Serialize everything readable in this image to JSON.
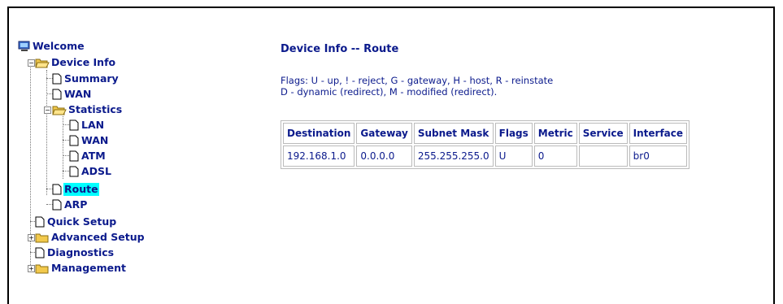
{
  "nav": {
    "welcome": "Welcome",
    "device_info": "Device Info",
    "summary": "Summary",
    "wan": "WAN",
    "statistics": "Statistics",
    "stats_lan": "LAN",
    "stats_wan": "WAN",
    "stats_atm": "ATM",
    "stats_adsl": "ADSL",
    "route": "Route",
    "arp": "ARP",
    "quick_setup": "Quick Setup",
    "advanced_setup": "Advanced Setup",
    "diagnostics": "Diagnostics",
    "management": "Management"
  },
  "page": {
    "title": "Device Info -- Route",
    "flags_line1": "Flags: U - up, ! - reject, G - gateway, H - host, R - reinstate",
    "flags_line2": "D - dynamic (redirect), M - modified (redirect)."
  },
  "table": {
    "headers": [
      "Destination",
      "Gateway",
      "Subnet Mask",
      "Flags",
      "Metric",
      "Service",
      "Interface"
    ],
    "rows": [
      [
        "192.168.1.0",
        "0.0.0.0",
        "255.255.255.0",
        "U",
        "0",
        "",
        "br0"
      ]
    ]
  },
  "colors": {
    "text": "#0b1a8c",
    "selected_bg": "#00ffff",
    "folder": "#f2c94c"
  }
}
